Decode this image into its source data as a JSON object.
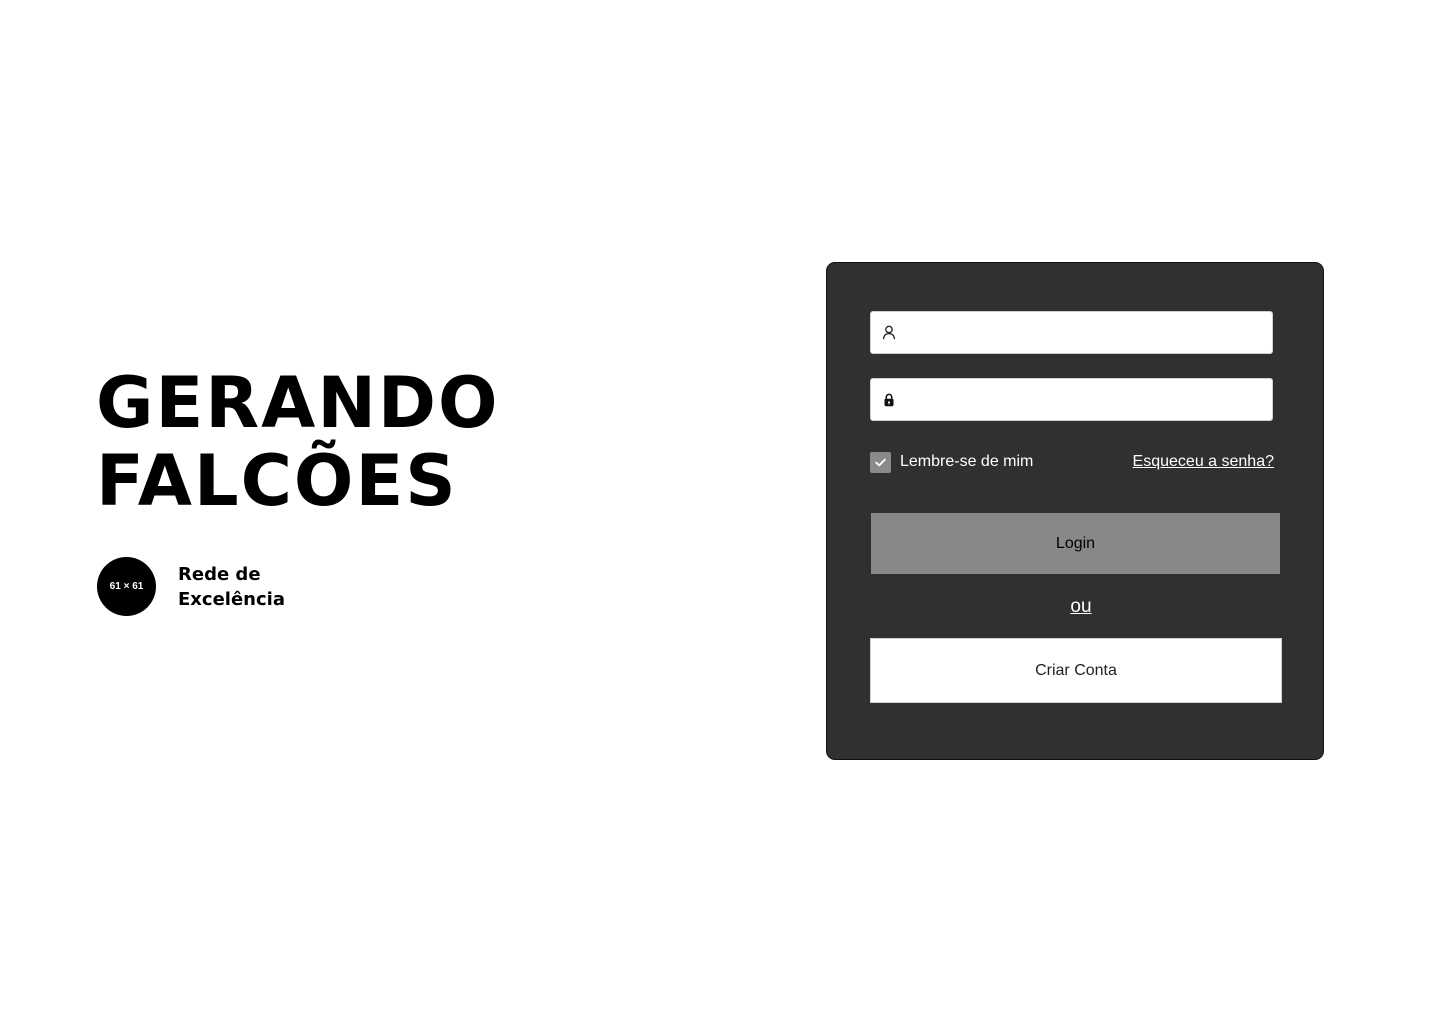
{
  "brand": {
    "title_line1": "GERANDO",
    "title_line2": "FALCÕES",
    "badge_text": "61 × 61",
    "network_line1": "Rede de",
    "network_line2": "Excelência"
  },
  "login_form": {
    "username": {
      "value": "",
      "icon": "user-icon"
    },
    "password": {
      "value": "",
      "icon": "lock-icon"
    },
    "remember_label": "Lembre-se de mim",
    "remember_checked": true,
    "forgot_label": "Esqueceu a senha?",
    "login_label": "Login",
    "or_label": "ou",
    "create_label": "Criar Conta"
  },
  "colors": {
    "card_background": "#303030",
    "login_button": "#888888",
    "checkbox": "#8a8a8a",
    "text_dark": "#000000",
    "text_light": "#ffffff"
  }
}
